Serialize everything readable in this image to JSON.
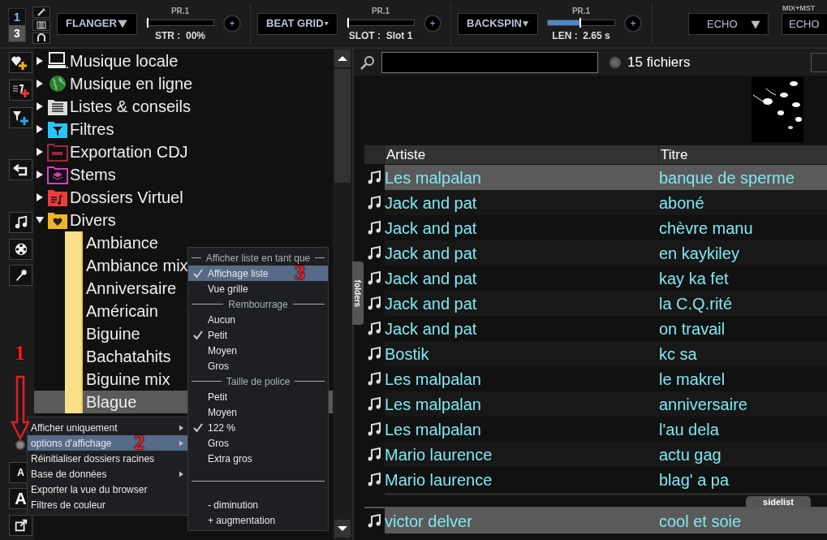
{
  "decks": [
    {
      "label": "1",
      "selected": false
    },
    {
      "label": "3",
      "selected": true
    }
  ],
  "effects": [
    {
      "name": "FLANGER",
      "preset": "PR.1",
      "level": 0,
      "reading": "STR :  00%",
      "button": "+"
    },
    {
      "name": "BEAT GRID",
      "preset": "PR.1",
      "level": 0,
      "reading": "SLOT :  Slot 1",
      "button": "+"
    },
    {
      "name": "BACKSPIN",
      "preset": "PR.1",
      "level": 0.47,
      "reading": "LEN :  2.65 s",
      "button": "+"
    }
  ],
  "master": {
    "label": "MIX+MST",
    "slots": [
      "ECHO",
      "ECHO"
    ]
  },
  "left_tools": {
    "font_small": "A",
    "font_large": "A"
  },
  "tree": [
    {
      "label": "Musique locale",
      "expanded": false
    },
    {
      "label": "Musique en ligne",
      "expanded": false
    },
    {
      "label": "Listes & conseils",
      "expanded": false
    },
    {
      "label": "Filtres",
      "expanded": false
    },
    {
      "label": "Exportation CDJ",
      "expanded": false
    },
    {
      "label": "Stems",
      "expanded": false
    },
    {
      "label": "Dossiers Virtuel",
      "expanded": false
    },
    {
      "label": "Divers",
      "expanded": true,
      "children": [
        {
          "label": "Ambiance",
          "selected": false
        },
        {
          "label": "Ambiance mix",
          "selected": false
        },
        {
          "label": "Anniversaire",
          "selected": false
        },
        {
          "label": "Américain",
          "selected": false
        },
        {
          "label": "Biguine",
          "selected": false
        },
        {
          "label": "Bachatahits",
          "selected": false
        },
        {
          "label": "Biguine mix",
          "selected": false
        },
        {
          "label": "Blague",
          "selected": true
        }
      ]
    }
  ],
  "folders_tab": "folders",
  "search": {
    "count": "15 fichiers"
  },
  "table": {
    "columns": [
      "Artiste",
      "Titre"
    ],
    "rows": [
      {
        "artist": "Les malpalan",
        "title": "banque de sperme",
        "selected": true
      },
      {
        "artist": "Jack and pat",
        "title": "aboné",
        "selected": false
      },
      {
        "artist": "Jack and pat",
        "title": "chèvre manu",
        "selected": false
      },
      {
        "artist": "Jack and pat",
        "title": "en kaykiley",
        "selected": false
      },
      {
        "artist": "Jack and pat",
        "title": "kay ka fet",
        "selected": false
      },
      {
        "artist": "Jack and pat",
        "title": "la C.Q.rité",
        "selected": false
      },
      {
        "artist": "Jack and pat",
        "title": "on travail",
        "selected": false
      },
      {
        "artist": "Bostik",
        "title": "kc sa",
        "selected": false
      },
      {
        "artist": "Les malpalan",
        "title": "le makrel",
        "selected": false
      },
      {
        "artist": "Les malpalan",
        "title": "anniversaire",
        "selected": false
      },
      {
        "artist": "Les malpalan",
        "title": "l'au dela",
        "selected": false
      },
      {
        "artist": "Mario laurence",
        "title": "actu gag",
        "selected": false
      },
      {
        "artist": "Mario laurence",
        "title": "blag' a pa",
        "selected": false
      }
    ]
  },
  "sidelist": {
    "tab": "sidelist",
    "rows": [
      {
        "artist": "victor delver",
        "title": "cool et soie",
        "selected": true
      }
    ]
  },
  "context_menu": [
    {
      "label": "Afficher uniquement",
      "submenu": true,
      "selected": false
    },
    {
      "label": "options d'affichage",
      "submenu": true,
      "selected": true
    },
    {
      "label": "Réinitialiser dossiers racines",
      "submenu": false,
      "selected": false
    },
    {
      "label": "Base de données",
      "submenu": true,
      "selected": false
    },
    {
      "label": "Exporter la vue du browser",
      "submenu": false,
      "selected": false
    },
    {
      "label": "Filtres de couleur",
      "submenu": false,
      "selected": false
    }
  ],
  "submenu": [
    {
      "kind": "header",
      "label": "Afficher liste en tant que"
    },
    {
      "kind": "item",
      "label": "Affichage liste",
      "checked": true,
      "selected": true
    },
    {
      "kind": "item",
      "label": "Vue grille",
      "checked": false,
      "selected": false
    },
    {
      "kind": "header",
      "label": "Rembourrage"
    },
    {
      "kind": "item",
      "label": "Aucun",
      "checked": false,
      "selected": false
    },
    {
      "kind": "item",
      "label": "Petit",
      "checked": true,
      "selected": false
    },
    {
      "kind": "item",
      "label": "Moyen",
      "checked": false,
      "selected": false
    },
    {
      "kind": "item",
      "label": "Gros",
      "checked": false,
      "selected": false
    },
    {
      "kind": "header",
      "label": "Taille de police"
    },
    {
      "kind": "item",
      "label": "Petit",
      "checked": false,
      "selected": false
    },
    {
      "kind": "item",
      "label": "Moyen",
      "checked": false,
      "selected": false
    },
    {
      "kind": "item",
      "label": "122 %",
      "checked": true,
      "selected": false
    },
    {
      "kind": "item",
      "label": "Gros",
      "checked": false,
      "selected": false
    },
    {
      "kind": "item",
      "label": "Extra gros",
      "checked": false,
      "selected": false
    },
    {
      "kind": "separator"
    },
    {
      "kind": "item",
      "label": "- diminution",
      "checked": false,
      "selected": false
    },
    {
      "kind": "item",
      "label": "+ augmentation",
      "checked": false,
      "selected": false
    }
  ],
  "annotations": [
    "1",
    "2",
    "3"
  ]
}
